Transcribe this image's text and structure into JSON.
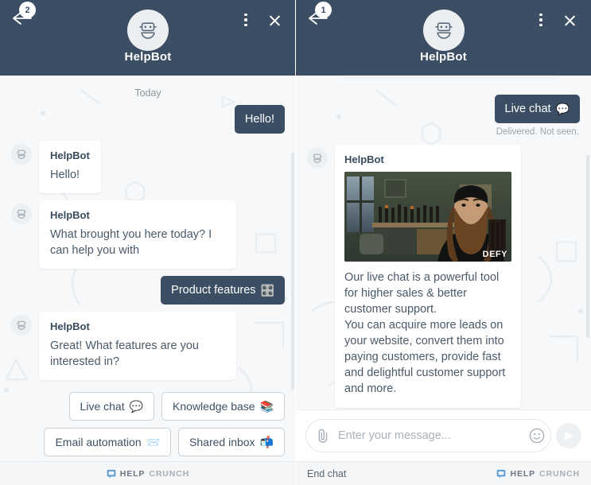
{
  "left_panel": {
    "header": {
      "badge_count": "2",
      "title": "HelpBot",
      "back_icon": "arrow-left-icon",
      "avatar_icon": "robot-avatar-icon",
      "menu_icon": "more-options-icon",
      "close_icon": "close-icon"
    },
    "day_label": "Today",
    "messages": [
      {
        "side": "out",
        "text": "Hello!"
      },
      {
        "side": "in",
        "who": "HelpBot",
        "text": "Hello!"
      },
      {
        "side": "in",
        "who": "HelpBot",
        "text": "What brought you here today? I can help you with"
      },
      {
        "side": "out",
        "text": "Product features",
        "emoji": "🎛️"
      },
      {
        "side": "in",
        "who": "HelpBot",
        "text": "Great! What features are you interested in?"
      }
    ],
    "quick_replies": [
      {
        "label": "Live chat",
        "emoji": "💬"
      },
      {
        "label": "Knowledge base",
        "emoji": "📚"
      },
      {
        "label": "Email automation",
        "emoji": "📨"
      },
      {
        "label": "Shared inbox",
        "emoji": "📬"
      }
    ],
    "footer": {
      "brand_first": "HELP",
      "brand_second": "CRUNCH",
      "brand_icon": "helpcrunch-logo-icon"
    }
  },
  "right_panel": {
    "header": {
      "badge_count": "1",
      "title": "HelpBot",
      "back_icon": "arrow-left-icon",
      "avatar_icon": "robot-avatar-icon",
      "menu_icon": "more-options-icon",
      "close_icon": "close-icon"
    },
    "outgoing": {
      "text": "Live chat",
      "emoji": "💬",
      "status": "Delivered. Not seen."
    },
    "media_message": {
      "who": "HelpBot",
      "image_alt": "bearded-man-gif",
      "watermark": "DEFY",
      "body": "Our live chat is a powerful tool for higher sales & better customer support.\nYou can acquire more leads on your website, convert them into paying customers, provide fast and delightful customer support and more."
    },
    "composer": {
      "attach_icon": "paperclip-icon",
      "placeholder": "Enter your message...",
      "value": "",
      "emoji_icon": "smiley-icon",
      "send_icon": "send-icon"
    },
    "footer": {
      "end_chat": "End chat",
      "brand_first": "HELP",
      "brand_second": "CRUNCH",
      "brand_icon": "helpcrunch-logo-icon"
    }
  },
  "colors": {
    "header_bg": "#3b4e63",
    "bubble_out_bg": "#3b4e63",
    "chat_bg": "#f6f8fa",
    "bubble_in_bg": "#ffffff",
    "text_muted": "#8a94a0"
  }
}
